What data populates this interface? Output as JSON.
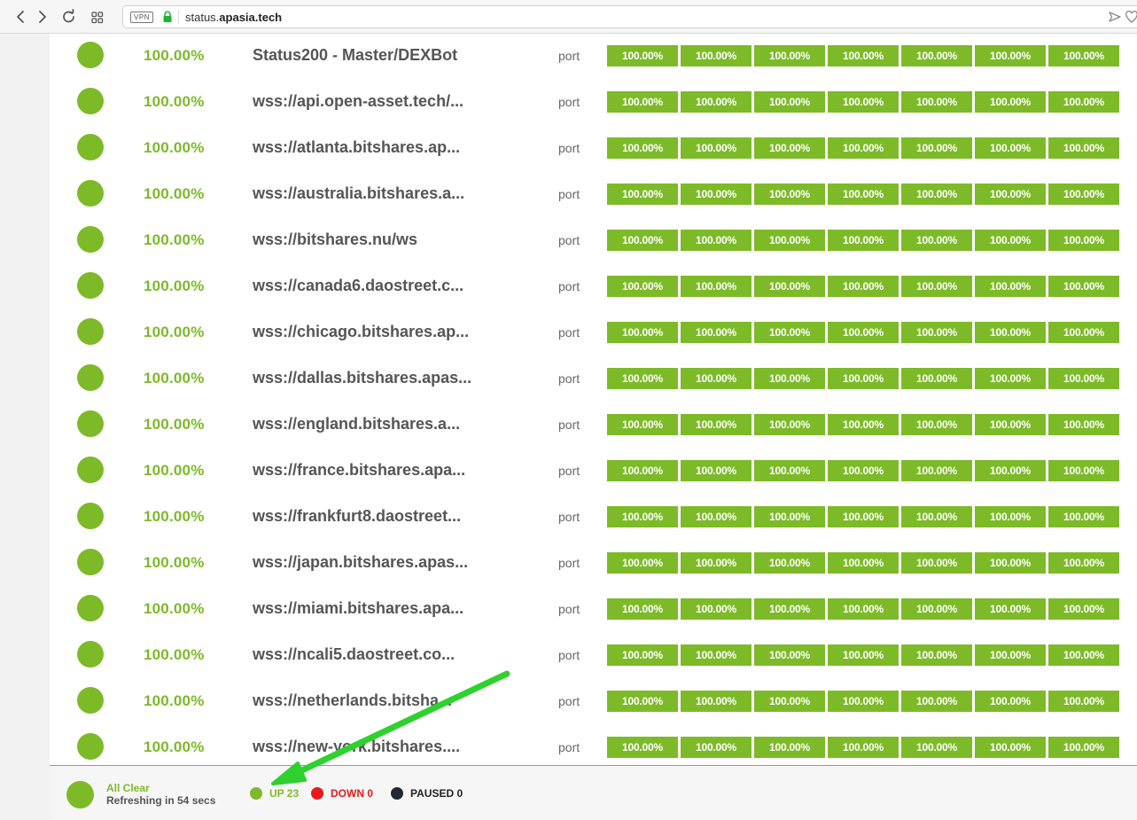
{
  "browser": {
    "vpn_label": "VPN",
    "url_prefix": "status.",
    "url_host": "apasia.tech"
  },
  "monitors": [
    {
      "uptime": "100.00%",
      "name": "Status200 - Master/DEXBot",
      "type": "port",
      "bars": [
        "100.00%",
        "100.00%",
        "100.00%",
        "100.00%",
        "100.00%",
        "100.00%",
        "100.00%"
      ]
    },
    {
      "uptime": "100.00%",
      "name": "wss://api.open-asset.tech/...",
      "type": "port",
      "bars": [
        "100.00%",
        "100.00%",
        "100.00%",
        "100.00%",
        "100.00%",
        "100.00%",
        "100.00%"
      ]
    },
    {
      "uptime": "100.00%",
      "name": "wss://atlanta.bitshares.ap...",
      "type": "port",
      "bars": [
        "100.00%",
        "100.00%",
        "100.00%",
        "100.00%",
        "100.00%",
        "100.00%",
        "100.00%"
      ]
    },
    {
      "uptime": "100.00%",
      "name": "wss://australia.bitshares.a...",
      "type": "port",
      "bars": [
        "100.00%",
        "100.00%",
        "100.00%",
        "100.00%",
        "100.00%",
        "100.00%",
        "100.00%"
      ]
    },
    {
      "uptime": "100.00%",
      "name": "wss://bitshares.nu/ws",
      "type": "port",
      "bars": [
        "100.00%",
        "100.00%",
        "100.00%",
        "100.00%",
        "100.00%",
        "100.00%",
        "100.00%"
      ]
    },
    {
      "uptime": "100.00%",
      "name": "wss://canada6.daostreet.c...",
      "type": "port",
      "bars": [
        "100.00%",
        "100.00%",
        "100.00%",
        "100.00%",
        "100.00%",
        "100.00%",
        "100.00%"
      ]
    },
    {
      "uptime": "100.00%",
      "name": "wss://chicago.bitshares.ap...",
      "type": "port",
      "bars": [
        "100.00%",
        "100.00%",
        "100.00%",
        "100.00%",
        "100.00%",
        "100.00%",
        "100.00%"
      ]
    },
    {
      "uptime": "100.00%",
      "name": "wss://dallas.bitshares.apas...",
      "type": "port",
      "bars": [
        "100.00%",
        "100.00%",
        "100.00%",
        "100.00%",
        "100.00%",
        "100.00%",
        "100.00%"
      ]
    },
    {
      "uptime": "100.00%",
      "name": "wss://england.bitshares.a...",
      "type": "port",
      "bars": [
        "100.00%",
        "100.00%",
        "100.00%",
        "100.00%",
        "100.00%",
        "100.00%",
        "100.00%"
      ]
    },
    {
      "uptime": "100.00%",
      "name": "wss://france.bitshares.apa...",
      "type": "port",
      "bars": [
        "100.00%",
        "100.00%",
        "100.00%",
        "100.00%",
        "100.00%",
        "100.00%",
        "100.00%"
      ]
    },
    {
      "uptime": "100.00%",
      "name": "wss://frankfurt8.daostreet...",
      "type": "port",
      "bars": [
        "100.00%",
        "100.00%",
        "100.00%",
        "100.00%",
        "100.00%",
        "100.00%",
        "100.00%"
      ]
    },
    {
      "uptime": "100.00%",
      "name": "wss://japan.bitshares.apas...",
      "type": "port",
      "bars": [
        "100.00%",
        "100.00%",
        "100.00%",
        "100.00%",
        "100.00%",
        "100.00%",
        "100.00%"
      ]
    },
    {
      "uptime": "100.00%",
      "name": "wss://miami.bitshares.apa...",
      "type": "port",
      "bars": [
        "100.00%",
        "100.00%",
        "100.00%",
        "100.00%",
        "100.00%",
        "100.00%",
        "100.00%"
      ]
    },
    {
      "uptime": "100.00%",
      "name": "wss://ncali5.daostreet.co...",
      "type": "port",
      "bars": [
        "100.00%",
        "100.00%",
        "100.00%",
        "100.00%",
        "100.00%",
        "100.00%",
        "100.00%"
      ]
    },
    {
      "uptime": "100.00%",
      "name": "wss://netherlands.bitsha...",
      "type": "port",
      "bars": [
        "100.00%",
        "100.00%",
        "100.00%",
        "100.00%",
        "100.00%",
        "100.00%",
        "100.00%"
      ]
    },
    {
      "uptime": "100.00%",
      "name": "wss://new-york.bitshares....",
      "type": "port",
      "bars": [
        "100.00%",
        "100.00%",
        "100.00%",
        "100.00%",
        "100.00%",
        "100.00%",
        "100.00%"
      ]
    }
  ],
  "footer": {
    "status_title": "All Clear",
    "status_sub": "Refreshing in 54 secs",
    "up_label": "UP 23",
    "down_label": "DOWN 0",
    "paused_label": "PAUSED 0"
  },
  "colors": {
    "up": "#7dba28",
    "down": "#e8191c",
    "paused": "#1f2a33",
    "arrow": "#2ed12e"
  }
}
